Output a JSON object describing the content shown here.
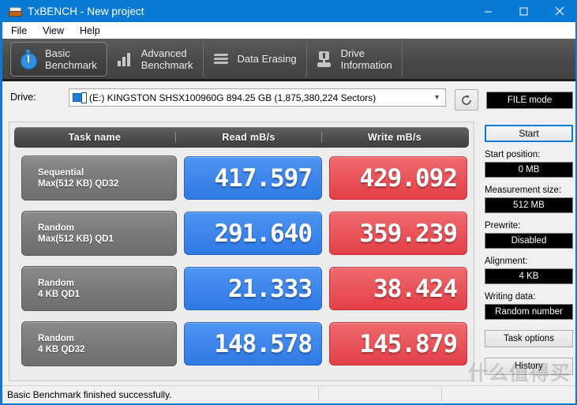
{
  "window": {
    "title": "TxBENCH - New project",
    "icon": "disk-icon",
    "controls": [
      {
        "name": "minimize-button",
        "glyph": "minimize-icon"
      },
      {
        "name": "maximize-button",
        "glyph": "maximize-icon"
      },
      {
        "name": "close-button",
        "glyph": "close-icon"
      }
    ]
  },
  "menu": {
    "items": [
      {
        "label": "File"
      },
      {
        "label": "View"
      },
      {
        "label": "Help"
      }
    ]
  },
  "tabs": [
    {
      "label": "Basic\nBenchmark",
      "icon": "stopwatch-icon",
      "active": true
    },
    {
      "label": "Advanced\nBenchmark",
      "icon": "bar-chart-icon",
      "active": false
    },
    {
      "label": "Data Erasing",
      "icon": "waves-icon",
      "active": false
    },
    {
      "label": "Drive\nInformation",
      "icon": "drive-icon",
      "active": false
    }
  ],
  "drive": {
    "label": "Drive:",
    "selected": "(E:) KINGSTON SHSX100960G  894.25 GB (1,875,380,224 Sectors)",
    "icon": "drive-select-icon",
    "dropdown_arrow": "chevron-down-icon",
    "refresh_icon": "refresh-icon",
    "file_mode_label": "FILE mode"
  },
  "results": {
    "columns": [
      "Task name",
      "Read mB/s",
      "Write mB/s"
    ],
    "rows": [
      {
        "task": "Sequential\nMax(512 KB) QD32",
        "read": "417.597",
        "write": "429.092"
      },
      {
        "task": "Random\nMax(512 KB) QD1",
        "read": "291.640",
        "write": "359.239"
      },
      {
        "task": "Random\n4 KB QD1",
        "read": "21.333",
        "write": "38.424"
      },
      {
        "task": "Random\n4 KB QD32",
        "read": "148.578",
        "write": "145.879"
      }
    ]
  },
  "sidebar": {
    "start_label": "Start",
    "fields": [
      {
        "label": "Start position:",
        "value": "0 MB"
      },
      {
        "label": "Measurement size:",
        "value": "512 MB"
      },
      {
        "label": "Prewrite:",
        "value": "Disabled"
      },
      {
        "label": "Alignment:",
        "value": "4 KB"
      },
      {
        "label": "Writing data:",
        "value": "Random number"
      }
    ],
    "buttons": [
      {
        "label": "Task options"
      },
      {
        "label": "History"
      }
    ]
  },
  "statusbar": {
    "message": "Basic Benchmark finished successfully."
  },
  "watermark": {
    "text": "什么值得买"
  },
  "colors": {
    "title_blue": "#0b7ad4",
    "read_blue": "#3b82ed",
    "write_red": "#e8474e",
    "tab_dark": "#4a4a4a",
    "field_black": "#000000"
  }
}
